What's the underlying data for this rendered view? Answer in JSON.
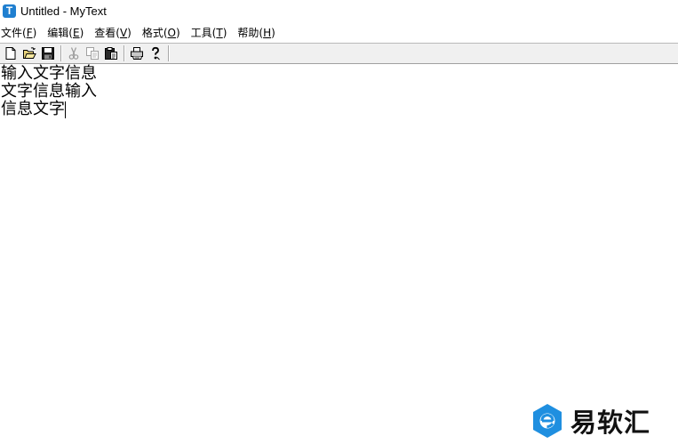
{
  "window": {
    "title": "Untitled - MyText",
    "app_icon_letter": "T",
    "accent_color": "#1f7fd0"
  },
  "menu": {
    "items": [
      {
        "label": "文件(",
        "key": "F",
        "close": ")"
      },
      {
        "label": "编辑(",
        "key": "E",
        "close": ")"
      },
      {
        "label": "查看(",
        "key": "V",
        "close": ")"
      },
      {
        "label": "格式(",
        "key": "O",
        "close": ")"
      },
      {
        "label": "工具(",
        "key": "T",
        "close": ")"
      },
      {
        "label": "帮助(",
        "key": "H",
        "close": ")"
      }
    ]
  },
  "toolbar": {
    "buttons": [
      {
        "icon": "new-document-icon",
        "enabled": true
      },
      {
        "icon": "open-folder-icon",
        "enabled": true
      },
      {
        "icon": "save-disk-icon",
        "enabled": true
      },
      {
        "icon": "cut-scissors-icon",
        "enabled": false
      },
      {
        "icon": "copy-icon",
        "enabled": false
      },
      {
        "icon": "paste-icon",
        "enabled": true
      },
      {
        "icon": "print-icon",
        "enabled": true
      },
      {
        "icon": "help-icon",
        "enabled": true
      }
    ]
  },
  "editor": {
    "lines": [
      "输入文字信息",
      "文字信息输入",
      "信息文字"
    ]
  },
  "watermark": {
    "text": "易软汇",
    "logo_icon": "yiruanhui-logo-icon",
    "logo_color": "#1f8fe0"
  }
}
